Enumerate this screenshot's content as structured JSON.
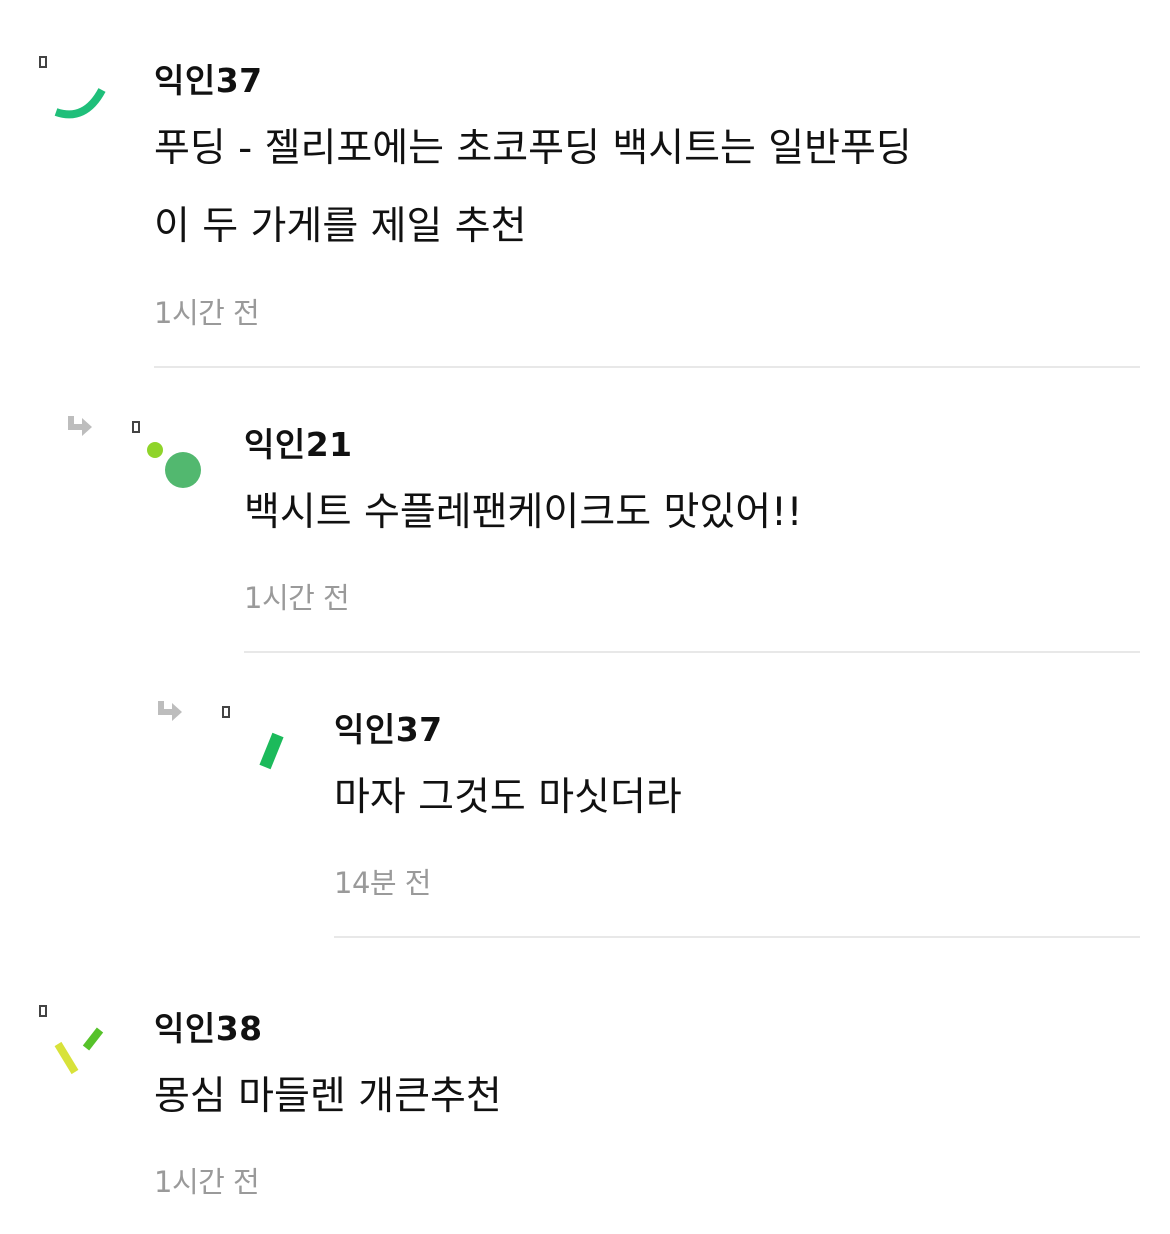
{
  "comments": [
    {
      "author": "익인37",
      "lines": [
        "푸딩 - 젤리포에는 초코푸딩 백시트는 일반푸딩",
        "이 두 가게를 제일 추천"
      ],
      "time": "1시간 전",
      "avatar_icon": "green-arc-avatar-icon",
      "is_reply": false
    },
    {
      "author": "익인21",
      "lines": [
        "백시트 수플레팬케이크도 맛있어!!"
      ],
      "time": "1시간 전",
      "avatar_icon": "green-dots-avatar-icon",
      "is_reply": true
    },
    {
      "author": "익인37",
      "lines": [
        "마자 그것도 마싯더라"
      ],
      "time": "14분 전",
      "avatar_icon": "green-dash-avatar-icon",
      "is_reply": true
    },
    {
      "author": "익인38",
      "lines": [
        "몽심 마들렌 개큰추천"
      ],
      "time": "1시간 전",
      "avatar_icon": "green-ticks-avatar-icon",
      "is_reply": false
    }
  ],
  "colors": {
    "avatar_green": "#1fbf7a",
    "avatar_dot_lime": "#8fd42a",
    "avatar_dot_green": "#52b86f",
    "avatar_dash_green": "#1cba5b",
    "avatar_tick_yellow": "#d8e23a",
    "avatar_tick_green": "#56c22a",
    "time_gray": "#9a9a9a",
    "divider": "#e8e8e8"
  },
  "icons": {
    "reply_arrow": "reply-arrow-icon",
    "avatar_badge": "small-badge-icon"
  }
}
